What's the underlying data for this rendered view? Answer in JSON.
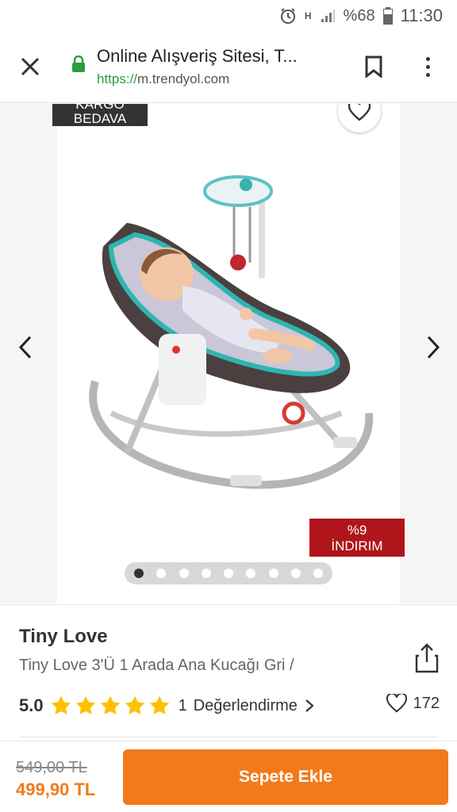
{
  "status_bar": {
    "time": "11:30",
    "battery": "%68",
    "network": "H",
    "icons": [
      "alarm-icon",
      "signal-icon",
      "battery-icon"
    ]
  },
  "toolbar": {
    "page_title": "Online Alışveriş Sitesi, T...",
    "url_scheme": "https://",
    "url_host": "m.trendyol.com",
    "icons": [
      "close-icon",
      "lock-icon",
      "bookmark-icon",
      "overflow-menu-icon"
    ],
    "lock_color": "#2a9d3c"
  },
  "gallery": {
    "cargo_badge_line1": "KARGO",
    "cargo_badge_line2": "BEDAVA",
    "discount_line1": "%9",
    "discount_line2": "İNDIRIM",
    "dot_count": 9,
    "active_dot": 1,
    "icons": [
      "heart-icon",
      "chevron-left-icon",
      "chevron-right-icon"
    ]
  },
  "product": {
    "brand": "Tiny Love",
    "name": "Tiny Love 3'Ü 1 Arada Ana Kucağı Gri /",
    "rating": "5.0",
    "stars": 5,
    "review_count": "1",
    "review_label": "Değerlendirme",
    "favorite_count": "172"
  },
  "purchase": {
    "old_price": "549,00 TL",
    "new_price": "499,90 TL",
    "add_to_cart": "Sepete Ekle",
    "accent_color": "#f27a1a",
    "star_color": "#ffc000"
  }
}
